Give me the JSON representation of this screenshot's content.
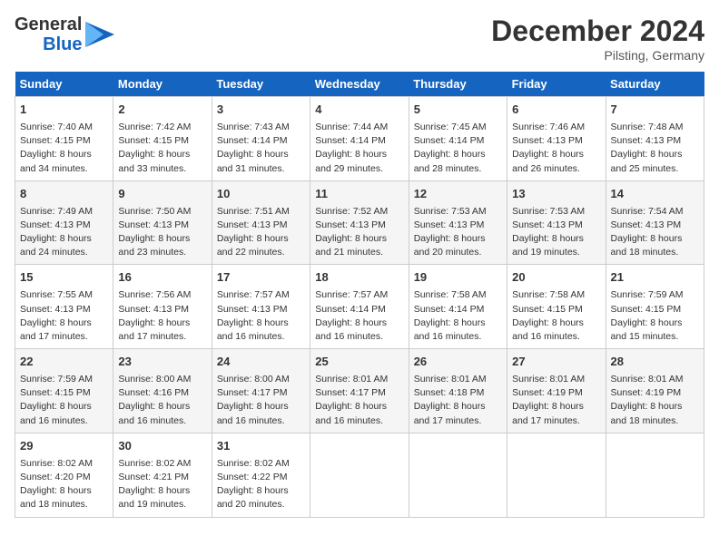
{
  "header": {
    "logo_line1": "General",
    "logo_line2": "Blue",
    "month_title": "December 2024",
    "location": "Pilsting, Germany"
  },
  "days_of_week": [
    "Sunday",
    "Monday",
    "Tuesday",
    "Wednesday",
    "Thursday",
    "Friday",
    "Saturday"
  ],
  "weeks": [
    [
      {
        "day": "1",
        "info": "Sunrise: 7:40 AM\nSunset: 4:15 PM\nDaylight: 8 hours\nand 34 minutes."
      },
      {
        "day": "2",
        "info": "Sunrise: 7:42 AM\nSunset: 4:15 PM\nDaylight: 8 hours\nand 33 minutes."
      },
      {
        "day": "3",
        "info": "Sunrise: 7:43 AM\nSunset: 4:14 PM\nDaylight: 8 hours\nand 31 minutes."
      },
      {
        "day": "4",
        "info": "Sunrise: 7:44 AM\nSunset: 4:14 PM\nDaylight: 8 hours\nand 29 minutes."
      },
      {
        "day": "5",
        "info": "Sunrise: 7:45 AM\nSunset: 4:14 PM\nDaylight: 8 hours\nand 28 minutes."
      },
      {
        "day": "6",
        "info": "Sunrise: 7:46 AM\nSunset: 4:13 PM\nDaylight: 8 hours\nand 26 minutes."
      },
      {
        "day": "7",
        "info": "Sunrise: 7:48 AM\nSunset: 4:13 PM\nDaylight: 8 hours\nand 25 minutes."
      }
    ],
    [
      {
        "day": "8",
        "info": "Sunrise: 7:49 AM\nSunset: 4:13 PM\nDaylight: 8 hours\nand 24 minutes."
      },
      {
        "day": "9",
        "info": "Sunrise: 7:50 AM\nSunset: 4:13 PM\nDaylight: 8 hours\nand 23 minutes."
      },
      {
        "day": "10",
        "info": "Sunrise: 7:51 AM\nSunset: 4:13 PM\nDaylight: 8 hours\nand 22 minutes."
      },
      {
        "day": "11",
        "info": "Sunrise: 7:52 AM\nSunset: 4:13 PM\nDaylight: 8 hours\nand 21 minutes."
      },
      {
        "day": "12",
        "info": "Sunrise: 7:53 AM\nSunset: 4:13 PM\nDaylight: 8 hours\nand 20 minutes."
      },
      {
        "day": "13",
        "info": "Sunrise: 7:53 AM\nSunset: 4:13 PM\nDaylight: 8 hours\nand 19 minutes."
      },
      {
        "day": "14",
        "info": "Sunrise: 7:54 AM\nSunset: 4:13 PM\nDaylight: 8 hours\nand 18 minutes."
      }
    ],
    [
      {
        "day": "15",
        "info": "Sunrise: 7:55 AM\nSunset: 4:13 PM\nDaylight: 8 hours\nand 17 minutes."
      },
      {
        "day": "16",
        "info": "Sunrise: 7:56 AM\nSunset: 4:13 PM\nDaylight: 8 hours\nand 17 minutes."
      },
      {
        "day": "17",
        "info": "Sunrise: 7:57 AM\nSunset: 4:13 PM\nDaylight: 8 hours\nand 16 minutes."
      },
      {
        "day": "18",
        "info": "Sunrise: 7:57 AM\nSunset: 4:14 PM\nDaylight: 8 hours\nand 16 minutes."
      },
      {
        "day": "19",
        "info": "Sunrise: 7:58 AM\nSunset: 4:14 PM\nDaylight: 8 hours\nand 16 minutes."
      },
      {
        "day": "20",
        "info": "Sunrise: 7:58 AM\nSunset: 4:15 PM\nDaylight: 8 hours\nand 16 minutes."
      },
      {
        "day": "21",
        "info": "Sunrise: 7:59 AM\nSunset: 4:15 PM\nDaylight: 8 hours\nand 15 minutes."
      }
    ],
    [
      {
        "day": "22",
        "info": "Sunrise: 7:59 AM\nSunset: 4:15 PM\nDaylight: 8 hours\nand 16 minutes."
      },
      {
        "day": "23",
        "info": "Sunrise: 8:00 AM\nSunset: 4:16 PM\nDaylight: 8 hours\nand 16 minutes."
      },
      {
        "day": "24",
        "info": "Sunrise: 8:00 AM\nSunset: 4:17 PM\nDaylight: 8 hours\nand 16 minutes."
      },
      {
        "day": "25",
        "info": "Sunrise: 8:01 AM\nSunset: 4:17 PM\nDaylight: 8 hours\nand 16 minutes."
      },
      {
        "day": "26",
        "info": "Sunrise: 8:01 AM\nSunset: 4:18 PM\nDaylight: 8 hours\nand 17 minutes."
      },
      {
        "day": "27",
        "info": "Sunrise: 8:01 AM\nSunset: 4:19 PM\nDaylight: 8 hours\nand 17 minutes."
      },
      {
        "day": "28",
        "info": "Sunrise: 8:01 AM\nSunset: 4:19 PM\nDaylight: 8 hours\nand 18 minutes."
      }
    ],
    [
      {
        "day": "29",
        "info": "Sunrise: 8:02 AM\nSunset: 4:20 PM\nDaylight: 8 hours\nand 18 minutes."
      },
      {
        "day": "30",
        "info": "Sunrise: 8:02 AM\nSunset: 4:21 PM\nDaylight: 8 hours\nand 19 minutes."
      },
      {
        "day": "31",
        "info": "Sunrise: 8:02 AM\nSunset: 4:22 PM\nDaylight: 8 hours\nand 20 minutes."
      },
      {
        "day": "",
        "info": ""
      },
      {
        "day": "",
        "info": ""
      },
      {
        "day": "",
        "info": ""
      },
      {
        "day": "",
        "info": ""
      }
    ]
  ]
}
